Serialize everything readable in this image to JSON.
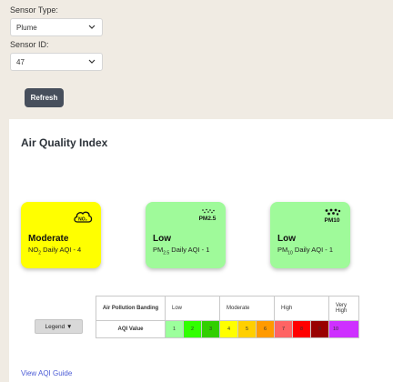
{
  "form": {
    "sensor_type_label": "Sensor Type:",
    "sensor_type_value": "Plume",
    "sensor_id_label": "Sensor ID:",
    "sensor_id_value": "47",
    "refresh_label": "Refresh"
  },
  "panel": {
    "title": "Air Quality Index",
    "cards": [
      {
        "level": "Moderate",
        "pollutant": "NO",
        "pollutant_sub": "2",
        "suffix": " Daily AQI - 4",
        "icon": "no2-cloud-icon",
        "color": "#ffff00"
      },
      {
        "level": "Low",
        "pollutant": "PM",
        "pollutant_sub": "2.5",
        "suffix": " Daily AQI - 1",
        "icon": "pm25-icon",
        "color": "#9ffa9a"
      },
      {
        "level": "Low",
        "pollutant": "PM",
        "pollutant_sub": "10",
        "suffix": " Daily AQI - 1",
        "icon": "pm10-icon",
        "color": "#9ffa9a"
      }
    ],
    "legend_button": "Legend ▼",
    "legend": {
      "banding_header": "Air Pollution Banding",
      "value_header": "AQI Value",
      "bands": [
        {
          "name": "Low",
          "span": 3
        },
        {
          "name": "Moderate",
          "span": 3
        },
        {
          "name": "High",
          "span": 3
        },
        {
          "name": "Very High",
          "span": 1
        }
      ],
      "values": [
        {
          "v": "1",
          "color": "#9cff9c"
        },
        {
          "v": "2",
          "color": "#31ff00"
        },
        {
          "v": "3",
          "color": "#31cf00"
        },
        {
          "v": "4",
          "color": "#ffff00"
        },
        {
          "v": "5",
          "color": "#ffcf00"
        },
        {
          "v": "6",
          "color": "#ff9a00"
        },
        {
          "v": "7",
          "color": "#ff6464"
        },
        {
          "v": "8",
          "color": "#ff0000"
        },
        {
          "v": "9",
          "color": "#990000"
        },
        {
          "v": "10",
          "color": "#ce30ff"
        }
      ]
    },
    "guide_link": "View AQI Guide"
  }
}
